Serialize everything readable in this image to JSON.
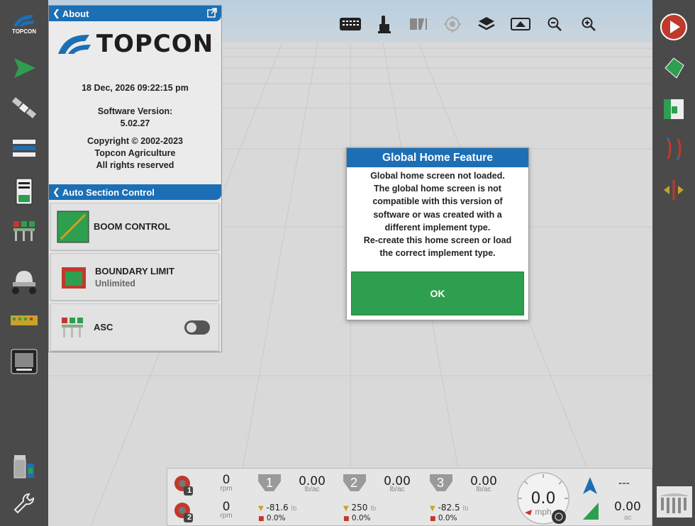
{
  "left_toolbar": {
    "brand_label": "TOPCON",
    "items": [
      {
        "icon": "topcon-logo-icon"
      },
      {
        "icon": "guidance-arrow-icon"
      },
      {
        "icon": "satellite-icon"
      },
      {
        "icon": "implement-setup-icon"
      },
      {
        "icon": "console-icon"
      },
      {
        "icon": "section-control-icon"
      },
      {
        "icon": "spreader-icon"
      },
      {
        "icon": "boom-sections-icon"
      },
      {
        "icon": "display-icon"
      },
      {
        "icon": "data-manager-icon"
      },
      {
        "icon": "wrench-icon"
      }
    ]
  },
  "top_toolbar": {
    "items": [
      "keyboard-icon",
      "touch-hand-icon",
      "spray-pattern-icon",
      "target-icon",
      "layers-icon",
      "map-view-icon",
      "zoom-out-icon",
      "zoom-in-icon"
    ]
  },
  "right_toolbar": {
    "items": [
      "record-icon",
      "field-boundary-icon",
      "boundary-limit-icon",
      "guidance-lines-icon",
      "headland-icon",
      "implement-view-icon"
    ]
  },
  "about_panel": {
    "header": "About",
    "logo_text": "TOPCON",
    "datetime": "18 Dec, 2026  09:22:15 pm",
    "software_version_label": "Software Version:",
    "software_version": "5.02.27",
    "copyright": "Copyright © 2002-2023",
    "company": "Topcon Agriculture",
    "rights": "All rights reserved"
  },
  "asc_panel": {
    "header": "Auto Section Control",
    "boom_control_label": "BOOM CONTROL",
    "boundary_limit_label": "BOUNDARY LIMIT",
    "boundary_limit_value": "Unlimited",
    "asc_label": "ASC",
    "asc_enabled": false
  },
  "dialog": {
    "title": "Global Home Feature",
    "lines": [
      "Global home screen not loaded.",
      "The global home screen is not",
      "compatible with this version of",
      "software or was created with a",
      "different implement type.",
      "Re-create this home screen or load",
      "the correct implement type."
    ],
    "ok_label": "OK"
  },
  "status_bar": {
    "fan1": {
      "badge": "1",
      "value": "0",
      "unit": "rpm"
    },
    "fan2": {
      "badge": "2",
      "value": "0",
      "unit": "rpm"
    },
    "bins": [
      {
        "num": "1",
        "rate": "0.00",
        "rate_unit": "lb/ac",
        "amount": "-81.6",
        "amount_unit": "lb",
        "percent": "0.0%"
      },
      {
        "num": "2",
        "rate": "0.00",
        "rate_unit": "lb/ac",
        "amount": "250",
        "amount_unit": "lb",
        "percent": "0.0%"
      },
      {
        "num": "3",
        "rate": "0.00",
        "rate_unit": "lb/ac",
        "amount": "-82.5",
        "amount_unit": "lb",
        "percent": "0.0%"
      }
    ],
    "speed": {
      "value": "0.0",
      "unit": "mph"
    },
    "heading_value": "---",
    "area": {
      "value": "0.00",
      "unit": "ac"
    }
  },
  "colors": {
    "accent_blue": "#1c6fb5",
    "ok_green": "#2e9e4f",
    "toolbar_gray": "#4a4a4a",
    "record_red": "#c0392b"
  }
}
